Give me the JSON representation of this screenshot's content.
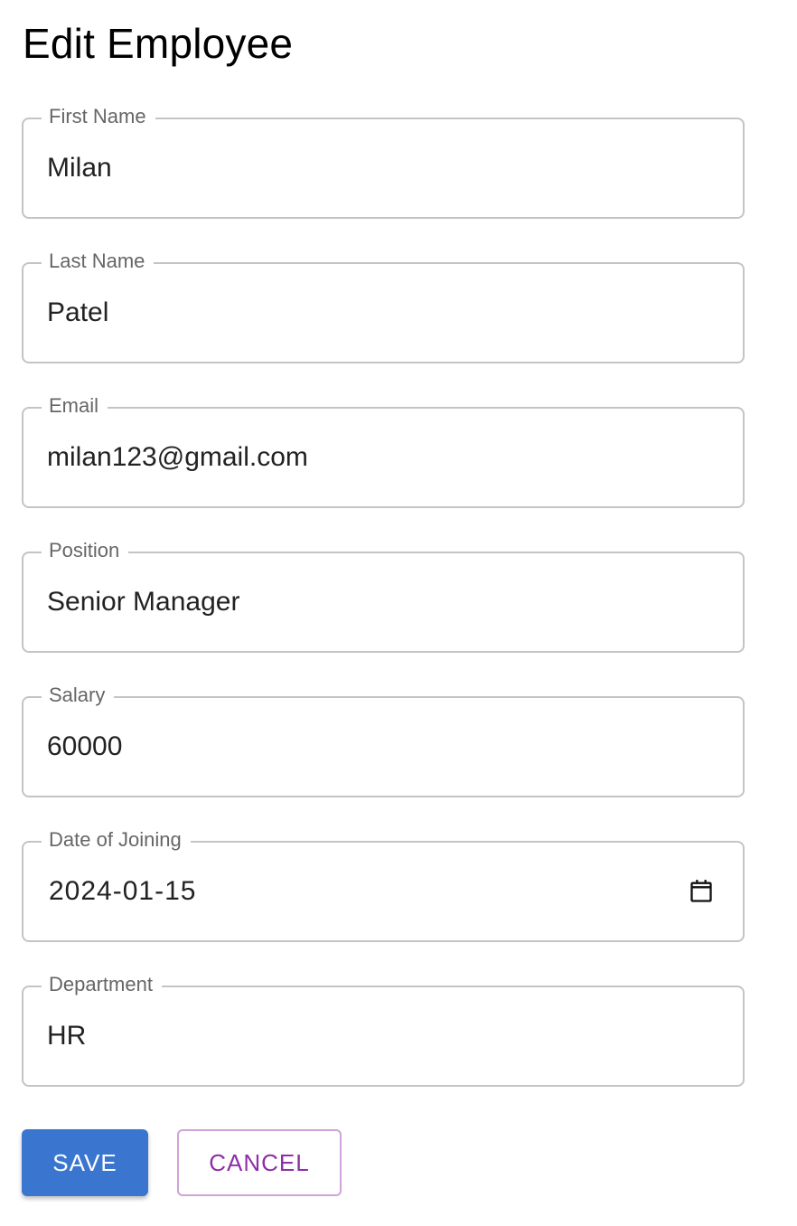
{
  "page": {
    "title": "Edit Employee"
  },
  "form": {
    "fields": [
      {
        "label": "First Name",
        "value": "Milan"
      },
      {
        "label": "Last Name",
        "value": "Patel"
      },
      {
        "label": "Email",
        "value": "milan123@gmail.com"
      },
      {
        "label": "Position",
        "value": "Senior Manager"
      },
      {
        "label": "Salary",
        "value": "60000"
      },
      {
        "label": "Date of Joining",
        "value": "2024-01-15",
        "icon": "calendar-icon"
      },
      {
        "label": "Department",
        "value": "HR"
      }
    ]
  },
  "actions": {
    "save_label": "SAVE",
    "cancel_label": "CANCEL"
  },
  "colors": {
    "save_button": "#3a76d0",
    "cancel_text": "#8e2fa8",
    "field_border": "#c4c4c4",
    "label": "#666666"
  }
}
